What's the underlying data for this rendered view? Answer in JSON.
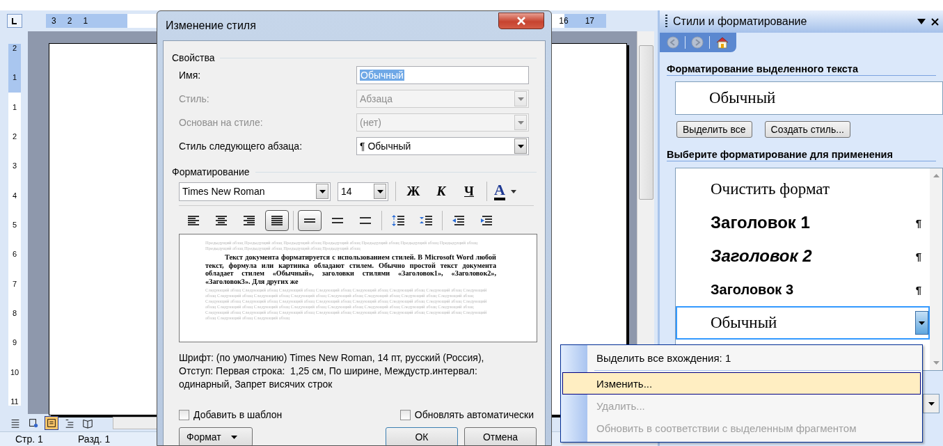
{
  "ruler": {
    "top_left_numbers": [
      "3",
      "2",
      "1"
    ],
    "top_right_numbers": [
      "16",
      "17"
    ],
    "side_numbers": [
      "2",
      "1",
      "1",
      "2",
      "3",
      "4",
      "5",
      "6",
      "7",
      "8",
      "9",
      "10",
      "11"
    ]
  },
  "view_buttons": [
    {
      "kind": "normal",
      "selected": false
    },
    {
      "kind": "web",
      "selected": false
    },
    {
      "kind": "print",
      "selected": true
    },
    {
      "kind": "outline",
      "selected": false
    },
    {
      "kind": "reading",
      "selected": false
    }
  ],
  "status_bar": {
    "page": "Стр. 1",
    "section": "Разд. 1"
  },
  "dialog": {
    "title": "Изменение стиля",
    "properties_heading": "Свойства",
    "fields": [
      {
        "label": "Имя:",
        "kind": "text",
        "value": "Обычный",
        "disabled": false
      },
      {
        "label": "Стиль:",
        "kind": "select",
        "value": "Абзаца",
        "disabled": true
      },
      {
        "label": "Основан на стиле:",
        "kind": "select",
        "value": "(нет)",
        "disabled": true
      },
      {
        "label": "Стиль следующего абзаца:",
        "kind": "select",
        "value": "¶ Обычный",
        "disabled": false
      }
    ],
    "formatting_heading": "Форматирование",
    "font": "Times New Roman",
    "size": "14",
    "char_buttons": [
      {
        "kind": "bold",
        "label": "Ж"
      },
      {
        "kind": "italic",
        "label": "К"
      },
      {
        "kind": "underline",
        "label": "Ч"
      }
    ],
    "color_button": "A",
    "paragraph_buttons": [
      {
        "kind": "align-left",
        "selected": false
      },
      {
        "kind": "align-center",
        "selected": false
      },
      {
        "kind": "align-right",
        "selected": false
      },
      {
        "kind": "justify",
        "selected": true
      },
      {
        "kind": "single",
        "selected": true
      },
      {
        "kind": "one-half",
        "selected": false
      },
      {
        "kind": "double",
        "selected": false
      },
      {
        "kind": "space-more",
        "selected": false
      },
      {
        "kind": "space-less",
        "selected": false
      },
      {
        "kind": "outdent",
        "selected": false
      },
      {
        "kind": "indent",
        "selected": false
      }
    ],
    "preview": {
      "previous": "Предыдущий абзац Предыдущий абзац Предыдущий абзац Предыдущий абзац Предыдущий абзац Предыдущий абзац Предыдущий абзац Предыдущий абзац Предыдущий абзац Предыдущий абзац Предыдущий абзац",
      "sample": "Текст документа форматируется с использованием стилей. В Microsoft Word любой текст, формула или картинка обладают стилем. Обычно простой текст документа обладает стилем «Обычный», заголовки стилями «Заголовок1», «Заголовок2», «Заголовок3». Для других же",
      "next": "Следующий абзац Следующий абзац Следующий абзац Следующий абзац Следующий абзац Следующий абзац Следующий абзац Следующий абзац Следующий абзац Следующий абзац Следующий абзац Следующий абзац Следующий абзац Следующий абзац Следующий абзац Следующий абзац Следующий абзац Следующий абзац Следующий абзац Следующий абзац Следующий абзац Следующий абзац Следующий абзац Следующий абзац Следующий абзац Следующий абзац Следующий абзац Следующий абзац Следующий абзац Следующий абзац Следующий абзац Следующий абзац Следующий абзац Следующий абзац Следующий абзац Следующий абзац Следующий абзац Следующий абзац Следующий абзац Следующий абзац"
    },
    "description": "Шрифт: (по умолчанию) Times New Roman, 14 пт, русский (Россия), Отступ: Первая строка:  1,25 см, По ширине, Междустр.интервал:  одинарный, Запрет висячих строк",
    "checkboxes": [
      {
        "label": "Добавить в шаблон",
        "checked": false
      },
      {
        "label": "Обновлять автоматически",
        "checked": false
      }
    ],
    "buttons": [
      {
        "kind": "menu",
        "label": "Формат"
      },
      {
        "kind": "default",
        "label": "ОК"
      },
      {
        "kind": "normal",
        "label": "Отмена"
      }
    ]
  },
  "task_pane": {
    "title": "Стили и форматирование",
    "nav": [
      {
        "kind": "back",
        "disabled": true
      },
      {
        "kind": "forward",
        "disabled": true
      },
      {
        "kind": "home",
        "disabled": false
      }
    ],
    "selected_heading": "Форматирование выделенного текста",
    "current_style": "Обычный",
    "buttons": [
      "Выделить все",
      "Создать стиль..."
    ],
    "apply_heading": "Выберите форматирование для применения",
    "styles": [
      {
        "kind": "clear",
        "name": "Очистить формат",
        "selected": false
      },
      {
        "kind": "heading1",
        "name": "Заголовок 1",
        "mark": "¶",
        "selected": false
      },
      {
        "kind": "heading2",
        "name": "Заголовок 2",
        "mark": "¶",
        "selected": false
      },
      {
        "kind": "heading3",
        "name": "Заголовок 3",
        "mark": "¶",
        "selected": false
      },
      {
        "kind": "normal",
        "name": "Обычный",
        "selected": true
      }
    ]
  },
  "context_menu": {
    "items": [
      {
        "label": "Выделить все вхождения: 1",
        "disabled": false,
        "selected": false
      },
      {
        "label": "Изменить...",
        "disabled": false,
        "selected": true
      },
      {
        "label": "Удалить...",
        "disabled": true,
        "selected": false
      },
      {
        "label": "Обновить в соответствии с выделенным фрагментом",
        "disabled": true,
        "selected": false
      }
    ]
  }
}
